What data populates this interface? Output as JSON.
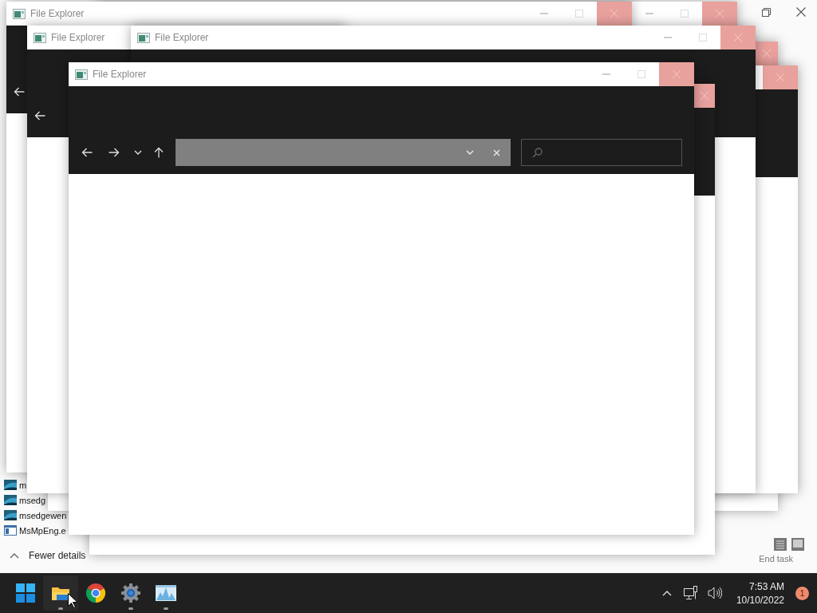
{
  "task_manager": {
    "processes": [
      {
        "kind": "image",
        "name": "m"
      },
      {
        "kind": "image",
        "name": "msedg"
      },
      {
        "kind": "image",
        "name": "msedgewen"
      },
      {
        "kind": "app",
        "name": "MsMpEng.e"
      }
    ],
    "details_toggle": "Fewer details",
    "end_task_button": "End task"
  },
  "windows": [
    {
      "kind": "back"
    },
    {
      "kind": "back",
      "title": "File Explorer"
    },
    {
      "kind": "back"
    },
    {
      "kind": "back"
    },
    {
      "kind": "back",
      "title": "File Explorer"
    },
    {
      "kind": "back",
      "title": "File Explorer"
    },
    {
      "kind": "back"
    },
    {
      "kind": "front",
      "title": "File Explorer"
    }
  ],
  "taskbar": {
    "apps": [
      {
        "kind": "start",
        "running": false
      },
      {
        "kind": "folder",
        "running": true
      },
      {
        "kind": "browser",
        "running": false
      },
      {
        "kind": "settings",
        "running": true
      },
      {
        "kind": "monitor",
        "running": true
      }
    ],
    "time": "7:53 AM",
    "date": "10/10/2022",
    "notification_count": "1"
  }
}
